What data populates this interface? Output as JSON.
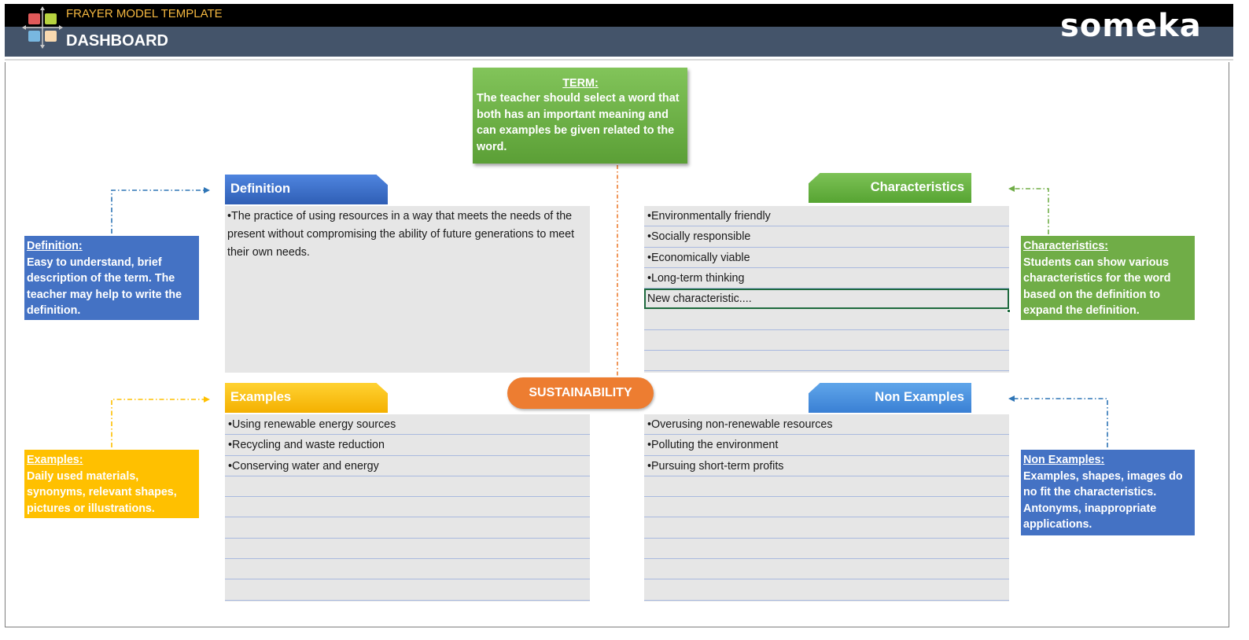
{
  "header": {
    "subtitle": "FRAYER MODEL TEMPLATE",
    "title": "DASHBOARD",
    "brand": "someka"
  },
  "term": {
    "title": "TERM:",
    "text": "The teacher should select a word that both has an important meaning and can examples be given related to the word."
  },
  "center_word": "SUSTAINABILITY",
  "definition": {
    "label": "Definition",
    "text": "•The practice of using resources in a way that meets the needs of the present without compromising the ability of future generations to meet their own needs."
  },
  "characteristics": {
    "label": "Characteristics",
    "items": [
      "•Environmentally friendly",
      "•Socially responsible",
      "•Economically viable",
      "•Long-term thinking",
      "New characteristic....",
      "",
      "",
      ""
    ]
  },
  "examples": {
    "label": "Examples",
    "items": [
      "•Using renewable energy sources",
      "•Recycling and waste reduction",
      "•Conserving water and energy",
      "",
      "",
      "",
      "",
      "",
      ""
    ]
  },
  "non_examples": {
    "label": "Non Examples",
    "items": [
      "•Overusing non-renewable resources",
      "•Polluting the environment",
      "•Pursuing short-term profits",
      "",
      "",
      "",
      "",
      "",
      ""
    ]
  },
  "notes": {
    "definition": {
      "title": "Definition:",
      "text": "Easy to understand, brief description of the term. The teacher may help to write the definition."
    },
    "characteristics": {
      "title": "Characteristics:",
      "text": "Students can show various characteristics for the word based on the definition to expand the definition."
    },
    "examples": {
      "title": "Examples:",
      "text": "Daily used materials, synonyms, relevant shapes, pictures or illustrations."
    },
    "non_examples": {
      "title": "Non Examples:",
      "text": "Examples, shapes, images do no fit the characteristics. Antonyms, inappropriate applications."
    }
  },
  "colors": {
    "header_dark": "#44546a",
    "header_top": "#000000",
    "subtitle": "#f5b840",
    "definition": "#4472c4",
    "characteristics": "#70ad47",
    "examples": "#ffc000",
    "non_examples": "#4472c4",
    "center": "#ed7d31",
    "term": "#70ad47",
    "box_fill": "#e6e6e6"
  },
  "icons": {
    "logo": "frayer-grid-icon"
  }
}
